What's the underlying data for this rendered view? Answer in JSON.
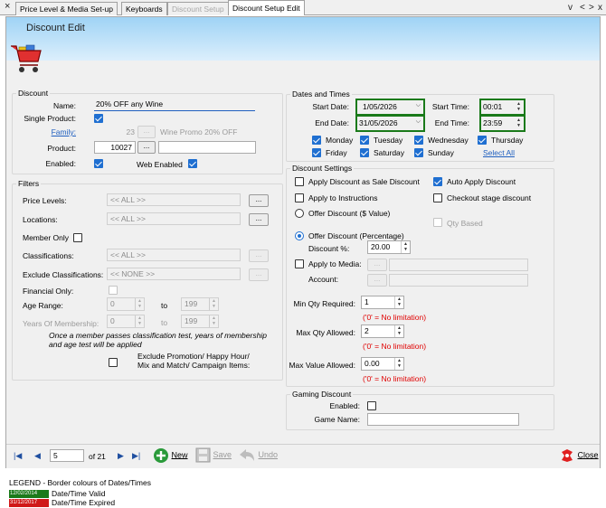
{
  "tabs": {
    "close": "×",
    "t1": "Price Level & Media Set-up",
    "t2": "Keyboards",
    "t3": "Discount Setup",
    "t4": "Discount Setup Edit",
    "nav_down": "v",
    "nav_left": "<",
    "nav_right": ">",
    "nav_close": "x"
  },
  "header": {
    "title": "Discount Edit",
    "icon": "shopping-cart-icon"
  },
  "discount": {
    "group": "Discount",
    "name_label": "Name:",
    "name_value": "20% OFF any Wine",
    "single_label": "Single Product:",
    "single_checked": true,
    "family_label": "Family:",
    "family_num": "23",
    "family_btn": "...",
    "family_value": "Wine Promo 20% OFF",
    "product_label": "Product:",
    "product_value": "10027",
    "product_btn": "...",
    "enabled_label": "Enabled:",
    "enabled_checked": true,
    "web_label": "Web Enabled",
    "web_checked": true
  },
  "filters": {
    "group": "Filters",
    "price_levels_label": "Price Levels:",
    "price_levels_value": "<< ALL >>",
    "locations_label": "Locations:",
    "locations_value": "<< ALL >>",
    "member_only_label": "Member Only",
    "classifications_label": "Classifications:",
    "classifications_value": "<< ALL >>",
    "excl_class_label": "Exclude Classifications:",
    "excl_class_value": "<< NONE >>",
    "financial_label": "Financial Only:",
    "age_label": "Age Range:",
    "age_from": "0",
    "age_to": "199",
    "to_label": "to",
    "years_label": "Years Of Membership:",
    "years_from": "0",
    "years_to": "199",
    "note": "Once a member passes classification test, years of membership and age test will be applied",
    "excl_promo_label": "Exclude Promotion/ Happy Hour/ Mix and Match/ Campaign Items:",
    "btn": "..."
  },
  "dates": {
    "group": "Dates and Times",
    "start_date_label": "Start Date:",
    "start_date": "1/05/2026",
    "end_date_label": "End Date:",
    "end_date": "31/05/2026",
    "start_time_label": "Start Time:",
    "start_time": "00:01",
    "end_time_label": "End Time:",
    "end_time": "23:59",
    "days": [
      "Monday",
      "Tuesday",
      "Wednesday",
      "Thursday",
      "Friday",
      "Saturday",
      "Sunday"
    ],
    "select_all": "Select All",
    "valid_border_color": "#1a7a1a"
  },
  "settings": {
    "group": "Discount Settings",
    "apply_sale": "Apply Discount as Sale Discount",
    "auto_apply": "Auto Apply Discount",
    "apply_instructions": "Apply to Instructions",
    "checkout_stage": "Checkout stage discount",
    "offer_dollar": "Offer Discount ($ Value)",
    "qty_based": "Qty Based",
    "offer_percent": "Offer Discount (Percentage)",
    "discount_pct_label": "Discount %:",
    "discount_pct": "20.00",
    "apply_media": "Apply to Media:",
    "account_label": "Account:",
    "min_qty_label": "Min Qty Required:",
    "min_qty": "1",
    "max_qty_label": "Max Qty Allowed:",
    "max_qty": "2",
    "max_value_label": "Max Value Allowed:",
    "max_value": "0.00",
    "no_limit": "('0' = No limitation)"
  },
  "gaming": {
    "group": "Gaming Discount",
    "enabled_label": "Enabled:",
    "game_name_label": "Game Name:",
    "game_name": ""
  },
  "bottom": {
    "page": "5",
    "of": "of 21",
    "new": "New",
    "save": "Save",
    "undo": "Undo",
    "close": "Close"
  },
  "legend": {
    "title": "LEGEND - Border colours of Dates/Times",
    "valid_sample": "12/02/2014",
    "valid_label": "Date/Time Valid",
    "valid_color": "#1a7a1a",
    "expired_sample": "31/12/2017",
    "expired_label": "Date/Time Expired",
    "expired_color": "#d01818"
  }
}
